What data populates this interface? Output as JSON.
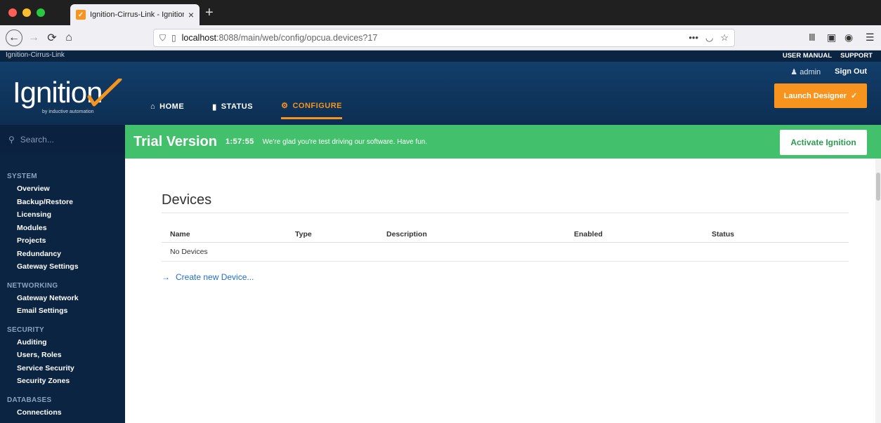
{
  "browser": {
    "tab_title": "Ignition-Cirrus-Link - Ignition G",
    "url_host": "localhost",
    "url_path": ":8088/main/web/config/opcua.devices?17"
  },
  "top": {
    "brand": "Ignition-Cirrus-Link",
    "links": [
      "USER MANUAL",
      "SUPPORT"
    ]
  },
  "header": {
    "logo": "Ignition",
    "logo_sub": "by inductive automation",
    "nav": [
      {
        "label": "HOME",
        "icon": "house-icon"
      },
      {
        "label": "STATUS",
        "icon": "bar-chart-icon"
      },
      {
        "label": "CONFIGURE",
        "icon": "gear-icon"
      }
    ],
    "user": "admin",
    "sign_out": "Sign Out",
    "launch": "Launch Designer"
  },
  "sidebar": {
    "search_placeholder": "Search...",
    "sections": [
      {
        "title": "SYSTEM",
        "items": [
          "Overview",
          "Backup/Restore",
          "Licensing",
          "Modules",
          "Projects",
          "Redundancy",
          "Gateway Settings"
        ]
      },
      {
        "title": "NETWORKING",
        "items": [
          "Gateway Network",
          "Email Settings"
        ]
      },
      {
        "title": "SECURITY",
        "items": [
          "Auditing",
          "Users, Roles",
          "Service Security",
          "Security Zones"
        ]
      },
      {
        "title": "DATABASES",
        "items": [
          "Connections"
        ]
      }
    ]
  },
  "trial": {
    "title": "Trial Version",
    "time": "1:57:55",
    "message": "We're glad you're test driving our software. Have fun.",
    "activate": "Activate Ignition"
  },
  "main": {
    "title": "Devices",
    "columns": [
      "Name",
      "Type",
      "Description",
      "Enabled",
      "Status"
    ],
    "empty_row": "No Devices",
    "create": "Create new Device..."
  },
  "colors": {
    "accent": "#f7941d",
    "trial": "#43c06b",
    "navy": "#0b2442"
  }
}
